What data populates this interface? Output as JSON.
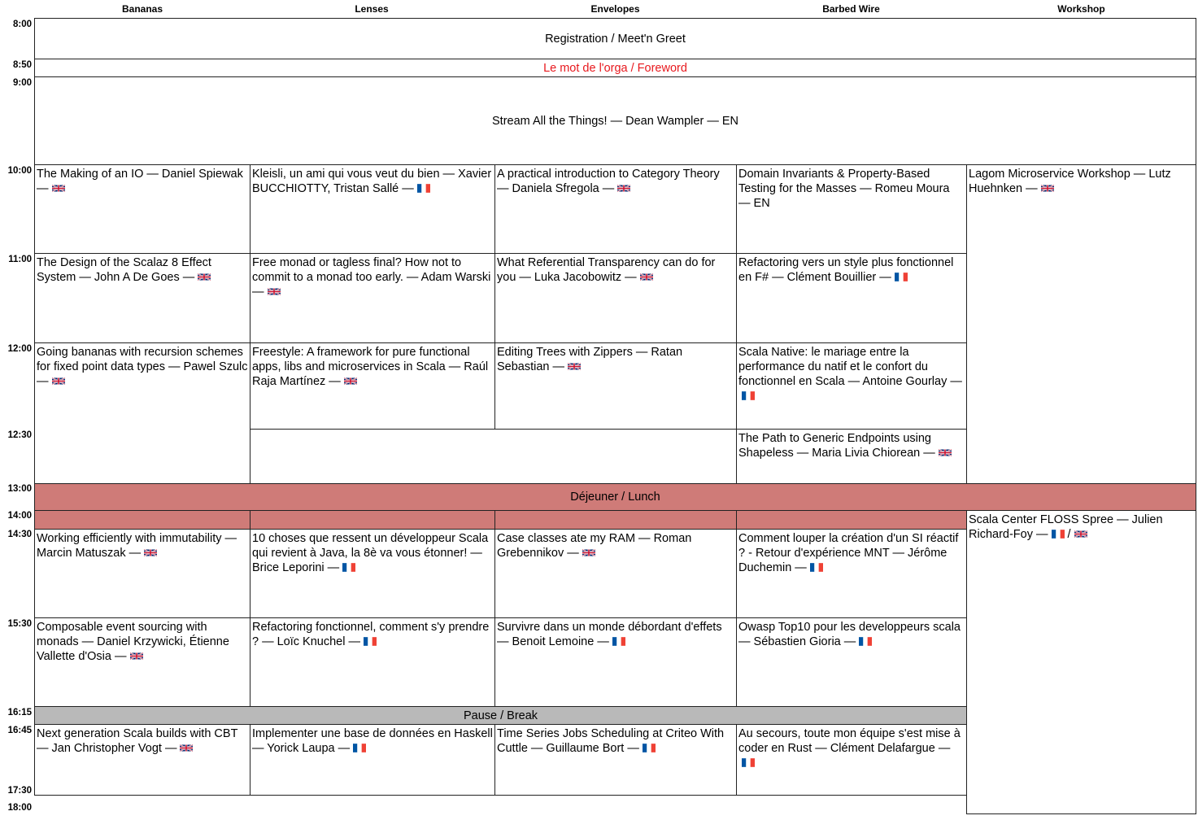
{
  "columns": [
    "Bananas",
    "Lenses",
    "Envelopes",
    "Barbed Wire",
    "Workshop"
  ],
  "times": [
    "8:00",
    "8:50",
    "9:00",
    "10:00",
    "11:00",
    "12:00",
    "12:30",
    "13:00",
    "14:00",
    "14:30",
    "15:30",
    "16:15",
    "16:45",
    "17:30",
    "18:00"
  ],
  "plenary": {
    "registration": "Registration / Meet'n Greet",
    "foreword": "Le mot de l'orga / Foreword",
    "keynote": "Stream All the Things! — Dean Wampler — EN",
    "lunch": "Déjeuner / Lunch",
    "pause": "Pause / Break"
  },
  "sessions": {
    "b1000": {
      "text": "The Making of an IO — Daniel Spiewak —",
      "flag": "uk-flag-icon"
    },
    "l1000": {
      "text": "Kleisli, un ami qui vous veut du bien — Xavier BUCCHIOTTY, Tristan Sallé —",
      "flag": "fr-flag-icon"
    },
    "e1000": {
      "text": "A practical introduction to Category Theory — Daniela Sfregola —",
      "flag": "uk-flag-icon"
    },
    "w1000": {
      "text": "Domain Invariants & Property-Based Testing for the Masses — Romeu Moura — EN"
    },
    "k1000": {
      "text": "Lagom Microservice Workshop — Lutz Huehnken —",
      "flag": "uk-flag-icon"
    },
    "b1100": {
      "text": "The Design of the Scalaz 8 Effect System — John A De Goes —",
      "flag": "uk-flag-icon"
    },
    "l1100": {
      "text": "Free monad or tagless final? How not to commit to a monad too early. — Adam Warski —",
      "flag": "uk-flag-icon"
    },
    "e1100": {
      "text": "What Referential Transparency can do for you — Luka Jacobowitz —",
      "flag": "uk-flag-icon"
    },
    "w1100": {
      "text": "Refactoring vers un style plus fonctionnel en F# — Clément Bouillier —",
      "flag": "fr-flag-icon"
    },
    "b1200": {
      "text": "Going bananas with recursion schemes for fixed point data types — Pawel Szulc —",
      "flag": "uk-flag-icon"
    },
    "l1200": {
      "text": "Freestyle: A framework for pure functional apps, libs and microservices in Scala — Raúl Raja Martínez —",
      "flag": "uk-flag-icon"
    },
    "e1200": {
      "text": "Editing Trees with Zippers — Ratan Sebastian —",
      "flag": "uk-flag-icon"
    },
    "w1200": {
      "text": "Scala Native: le mariage entre la performance du natif et le confort du fonctionnel en Scala — Antoine Gourlay —",
      "flag": "fr-flag-icon"
    },
    "w1230": {
      "text": "The Path to Generic Endpoints using Shapeless — Maria Livia Chiorean —",
      "flag": "uk-flag-icon"
    },
    "k1400": {
      "text": "Scala Center FLOSS Spree — Julien Richard-Foy —",
      "flag": "fr-flag-icon",
      "flag2": "uk-flag-icon",
      "sep": "/"
    },
    "b1430": {
      "text": "Working efficiently with immutability — Marcin Matuszak —",
      "flag": "uk-flag-icon"
    },
    "l1430": {
      "text": "10 choses que ressent un développeur Scala qui revient à Java, la 8è va vous étonner! — Brice Leporini —",
      "flag": "fr-flag-icon"
    },
    "e1430": {
      "text": "Case classes ate my RAM — Roman Grebennikov —",
      "flag": "uk-flag-icon"
    },
    "w1430": {
      "text": "Comment louper la création d'un SI réactif ? - Retour d'expérience MNT — Jérôme Duchemin —",
      "flag": "fr-flag-icon"
    },
    "b1530": {
      "text": "Composable event sourcing with monads — Daniel Krzywicki, Étienne Vallette d'Osia —",
      "flag": "uk-flag-icon"
    },
    "l1530": {
      "text": "Refactoring fonctionnel, comment s'y prendre ? — Loïc Knuchel —",
      "flag": "fr-flag-icon"
    },
    "e1530": {
      "text": "Survivre dans un monde débordant d'effets — Benoit Lemoine —",
      "flag": "fr-flag-icon"
    },
    "w1530": {
      "text": "Owasp Top10 pour les developpeurs scala — Sébastien Gioria —",
      "flag": "fr-flag-icon"
    },
    "b1645": {
      "text": "Next generation Scala builds with CBT — Jan Christopher Vogt —",
      "flag": "uk-flag-icon"
    },
    "l1645": {
      "text": "Implementer une base de données en Haskell — Yorick Laupa —",
      "flag": "fr-flag-icon"
    },
    "e1645": {
      "text": "Time Series Jobs Scheduling at Criteo With Cuttle — Guillaume Bort —",
      "flag": "fr-flag-icon"
    },
    "w1645": {
      "text": "Au secours, toute mon équipe s'est mise à coder en Rust — Clément Delafargue —",
      "flag": "fr-flag-icon"
    }
  }
}
